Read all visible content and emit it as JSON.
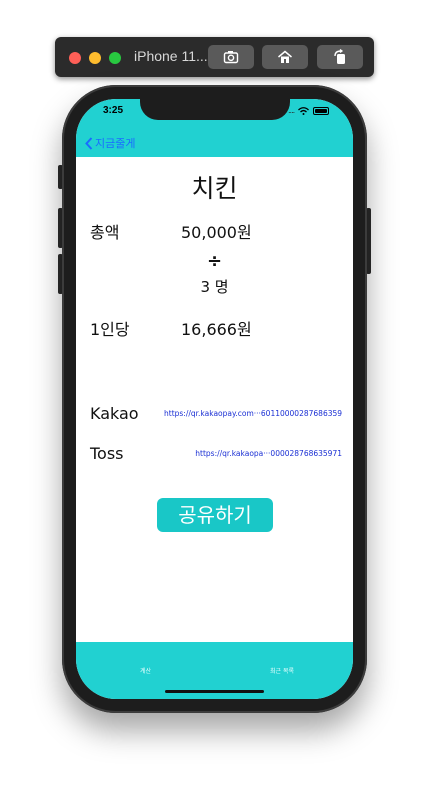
{
  "simulator": {
    "title": "iPhone 11..."
  },
  "status": {
    "time": "3:25",
    "signal": "...."
  },
  "nav": {
    "back_label": "지금줄게"
  },
  "main": {
    "title": "치킨",
    "total_label": "총액",
    "total_value": "50,000원",
    "divide_symbol": "÷",
    "people": "3 명",
    "per_person_label": "1인당",
    "per_person_value": "16,666원"
  },
  "payments": [
    {
      "label": "Kakao",
      "link": "https://qr.kakaopay.com···6011000028768635971"
    },
    {
      "label": "Toss",
      "link": "https://qr.kakaopa···000028768635971"
    }
  ],
  "share_button": "공유하기",
  "tabs": [
    {
      "label": "계산"
    },
    {
      "label": "최근 목록"
    }
  ],
  "colors": {
    "accent": "#21d1d1",
    "button": "#19c7c7",
    "link": "#1a2fd4",
    "back": "#1a6cff"
  }
}
